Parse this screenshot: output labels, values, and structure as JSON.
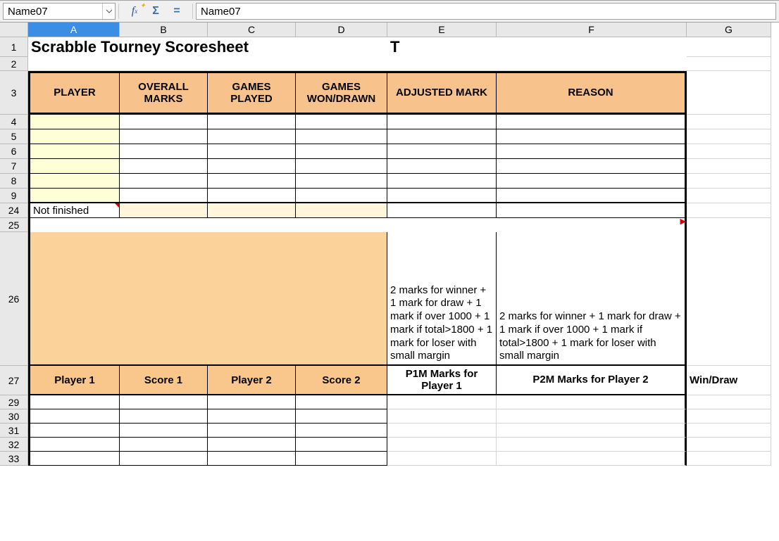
{
  "toolbar": {
    "namebox": "Name07",
    "formula": "Name07"
  },
  "columns": [
    "A",
    "B",
    "C",
    "D",
    "E",
    "F",
    "G"
  ],
  "title": "Scrabble Tourney Scoresheet",
  "tval": "T",
  "headers": {
    "player": "PLAYER",
    "overall_marks": "OVERALL MARKS",
    "games_played": "GAMES PLAYED",
    "games_won": "GAMES WON/DRAWN",
    "adjusted": "ADJUSTED MARK",
    "reason": "REASON"
  },
  "row24": {
    "a": "Not finished"
  },
  "note26_e": "2 marks for winner + 1 mark for draw + 1 mark if over 1000 + 1 mark if total>1800 + 1 mark for loser with small margin",
  "note26_f": "2 marks for winner + 1 mark for draw + 1 mark if over 1000 + 1 mark if total>1800 + 1 mark for loser with small margin",
  "h27": {
    "p1": "Player 1",
    "s1": "Score 1",
    "p2": "Player 2",
    "s2": "Score 2",
    "p1m": "P1M Marks for Player 1",
    "p2m": "P2M Marks for Player 2",
    "wd": "Win/Draw"
  },
  "visible_rows_top": [
    "1",
    "2",
    "3",
    "4",
    "5",
    "6",
    "7",
    "8",
    "9",
    "24",
    "25",
    "26",
    "27",
    "29",
    "30",
    "31",
    "32",
    "33"
  ]
}
